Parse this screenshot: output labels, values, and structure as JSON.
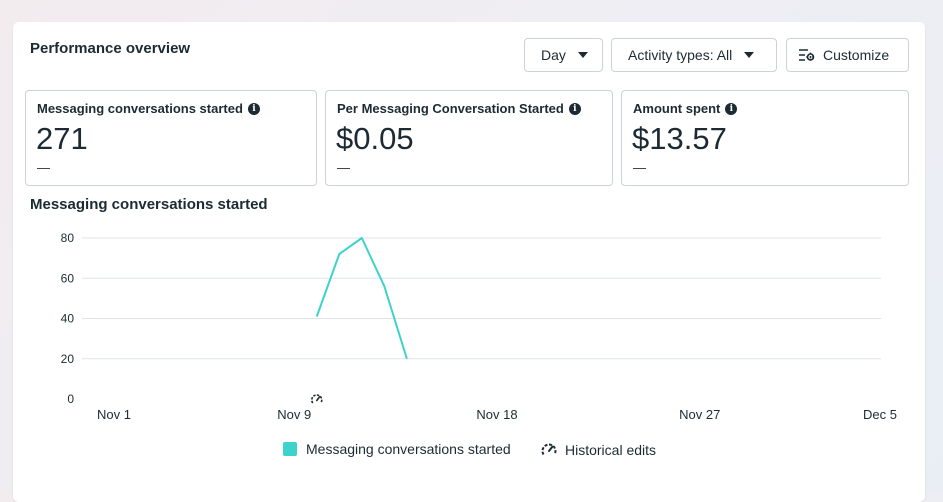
{
  "panel": {
    "title": "Performance overview",
    "controls": {
      "day_label": "Day",
      "activity_label": "Activity types: All",
      "customize_label": "Customize"
    }
  },
  "metrics": [
    {
      "label": "Messaging conversations started",
      "value": "271",
      "delta": "—"
    },
    {
      "label": "Per Messaging Conversation Started",
      "value": "$0.05",
      "delta": "—"
    },
    {
      "label": "Amount spent",
      "value": "$13.57",
      "delta": "—"
    }
  ],
  "chart_title": "Messaging conversations started",
  "chart_data": {
    "type": "line",
    "title": "Messaging conversations started",
    "x": [
      "Nov 10",
      "Nov 11",
      "Nov 12",
      "Nov 13",
      "Nov 14"
    ],
    "series": [
      {
        "name": "Messaging conversations started",
        "values": [
          41,
          72,
          80,
          56,
          20
        ],
        "color": "#3dd2cc"
      }
    ],
    "x_ticks": [
      "Nov 1",
      "Nov 9",
      "Nov 18",
      "Nov 27",
      "Dec 5"
    ],
    "x_tick_dates": [
      "2023-11-01",
      "2023-11-09",
      "2023-11-18",
      "2023-11-27",
      "2023-12-05"
    ],
    "y_ticks": [
      "0",
      "20",
      "40",
      "60",
      "80"
    ],
    "ylim": [
      0,
      80
    ],
    "grid": true,
    "historical_edit_marker": "Nov 10"
  },
  "legend": {
    "series_label": "Messaging conversations started",
    "series_color": "#3dd2cc",
    "edits_label": "Historical edits",
    "edits_icon": "gauge-edit-icon"
  }
}
